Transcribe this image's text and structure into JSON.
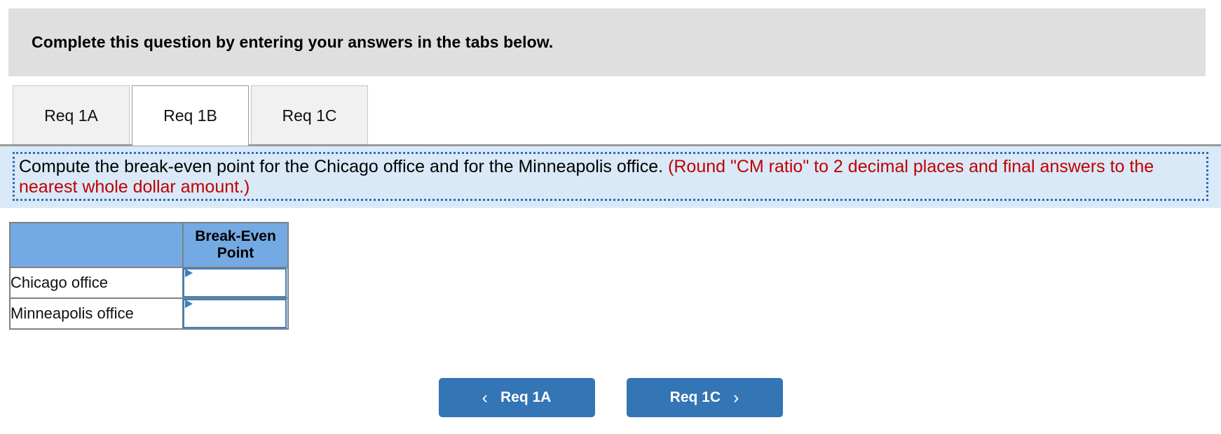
{
  "top_banner": {
    "text": "Complete this question by entering your answers in the tabs below."
  },
  "tabs": [
    {
      "id": "req-1a",
      "label": "Req 1A",
      "active": false
    },
    {
      "id": "req-1b",
      "label": "Req 1B",
      "active": true
    },
    {
      "id": "req-1c",
      "label": "Req 1C",
      "active": false
    }
  ],
  "question": {
    "main": "Compute the break-even point for the Chicago office and for the Minneapolis office.",
    "note": "(Round \"CM ratio\" to 2 decimal places and final answers to the nearest whole dollar amount.)"
  },
  "table": {
    "headers": [
      "",
      "Break-Even Point"
    ],
    "rows": [
      {
        "label": "Chicago office",
        "value": ""
      },
      {
        "label": "Minneapolis office",
        "value": ""
      }
    ]
  },
  "nav": {
    "prev_label": "Req 1A",
    "next_label": "Req 1C",
    "prev_icon": "chevron-left-icon",
    "next_icon": "chevron-right-icon",
    "prev_glyph": "‹",
    "next_glyph": "›"
  },
  "colors": {
    "top_banner_bg": "#dfdfdf",
    "question_bg": "#d9e9f7",
    "question_border": "#2f6fb5",
    "question_note_text": "#c00000",
    "table_header_bg": "#74aae3",
    "table_border": "#808080",
    "input_border": "#3d7fbd",
    "button_bg": "#3375b5",
    "tab_inactive_bg": "#f1f1f1",
    "tab_active_bg": "#ffffff"
  }
}
